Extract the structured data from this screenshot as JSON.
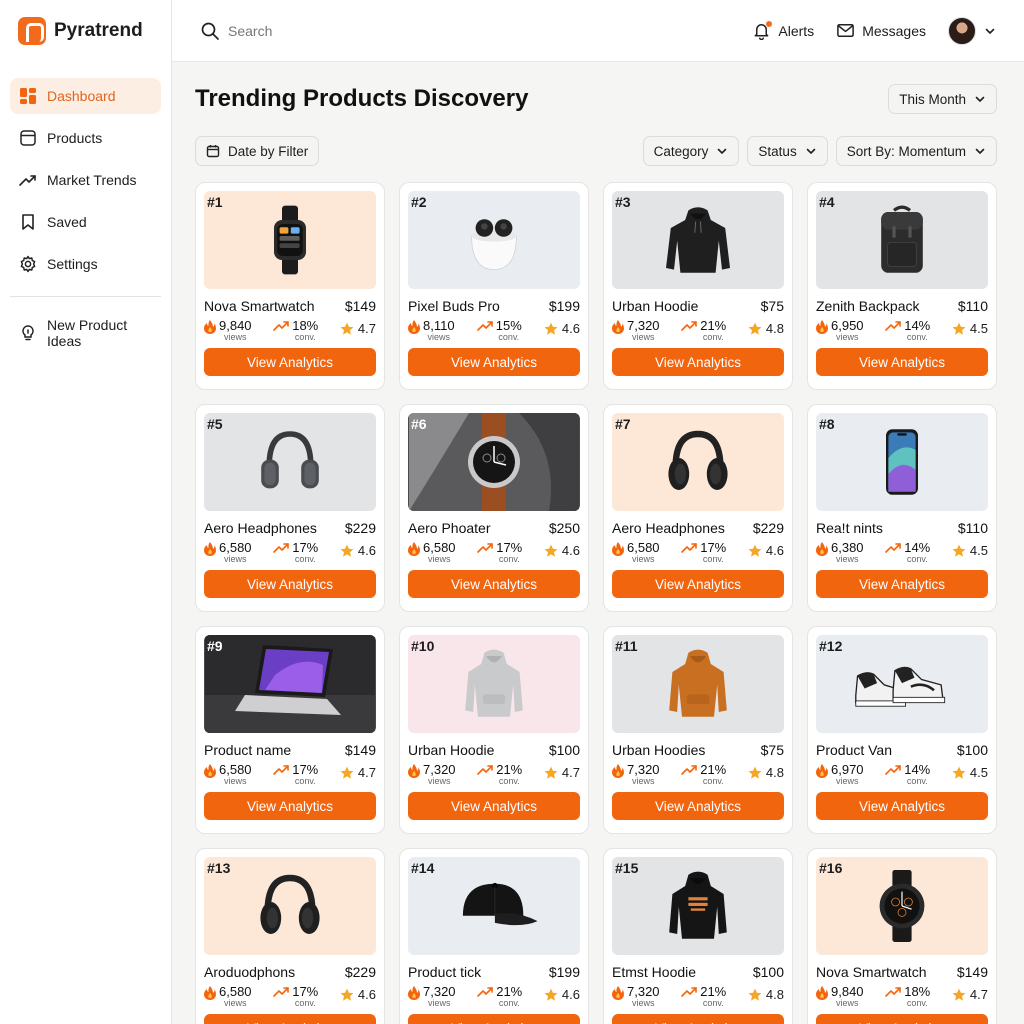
{
  "brand": {
    "name": "Pyratrend"
  },
  "sidebar": {
    "items": [
      {
        "label": "Dashboard",
        "icon": "dashboard-icon",
        "active": true
      },
      {
        "label": "Products",
        "icon": "box-icon"
      },
      {
        "label": "Market Trends",
        "icon": "trend-icon"
      },
      {
        "label": "Saved",
        "icon": "bookmark-icon"
      },
      {
        "label": "Settings",
        "icon": "gear-icon"
      }
    ],
    "secondary": {
      "label": "New Product Ideas",
      "icon": "lightbulb-icon"
    }
  },
  "topbar": {
    "search_placeholder": "Search",
    "alerts_label": "Alerts",
    "messages_label": "Messages"
  },
  "main": {
    "title": "Trending Products Discovery",
    "period_label": "This Month",
    "date_filter_label": "Date by Filter",
    "filters": {
      "category": "Category",
      "status": "Status",
      "sort": "Sort By: Momentum"
    },
    "button_label": "View Analytics",
    "views_caption": "views",
    "conv_caption": "conv."
  },
  "colors": {
    "accent": "#f2650f",
    "peach_bg": "#fde8d8",
    "gray_bg": "#e7e8ea",
    "pink_bg": "#f8e6ea"
  },
  "products": [
    {
      "rank": "#1",
      "name": "Nova Smartwatch",
      "price": "$149",
      "views": "9,840",
      "conv": "18%",
      "rating": "4.7",
      "image": "smartwatch",
      "bg": "peach"
    },
    {
      "rank": "#2",
      "name": "Pixel Buds Pro",
      "price": "$199",
      "views": "8,110",
      "conv": "15%",
      "rating": "4.6",
      "image": "earbuds",
      "bg": "light"
    },
    {
      "rank": "#3",
      "name": "Urban Hoodie",
      "price": "$75",
      "views": "7,320",
      "conv": "21%",
      "rating": "4.8",
      "image": "hoodie-black",
      "bg": "gray"
    },
    {
      "rank": "#4",
      "name": "Zenith Backpack",
      "price": "$110",
      "views": "6,950",
      "conv": "14%",
      "rating": "4.5",
      "image": "backpack",
      "bg": "gray"
    },
    {
      "rank": "#5",
      "name": "Aero Headphones",
      "price": "$229",
      "views": "6,580",
      "conv": "17%",
      "rating": "4.6",
      "image": "headphones-gray",
      "bg": "gray"
    },
    {
      "rank": "#6",
      "name": "Aero Phoater",
      "price": "$250",
      "views": "6,580",
      "conv": "17%",
      "rating": "4.6",
      "image": "watch-leather",
      "bg": "dark"
    },
    {
      "rank": "#7",
      "name": "Aero Headphones",
      "price": "$229",
      "views": "6,580",
      "conv": "17%",
      "rating": "4.6",
      "image": "headphones-black",
      "bg": "peach"
    },
    {
      "rank": "#8",
      "name": "Rea!t nints",
      "price": "$110",
      "views": "6,380",
      "conv": "14%",
      "rating": "4.5",
      "image": "phone",
      "bg": "light"
    },
    {
      "rank": "#9",
      "name": "Product name",
      "price": "$149",
      "views": "6,580",
      "conv": "17%",
      "rating": "4.7",
      "image": "laptop",
      "bg": "dark"
    },
    {
      "rank": "#10",
      "name": "Urban Hoodie",
      "price": "$100",
      "views": "7,320",
      "conv": "21%",
      "rating": "4.7",
      "image": "hoodie-gray",
      "bg": "pink"
    },
    {
      "rank": "#11",
      "name": "Urban Hoodies",
      "price": "$75",
      "views": "7,320",
      "conv": "21%",
      "rating": "4.8",
      "image": "hoodie-orange",
      "bg": "gray"
    },
    {
      "rank": "#12",
      "name": "Product Van",
      "price": "$100",
      "views": "6,970",
      "conv": "14%",
      "rating": "4.5",
      "image": "sneakers",
      "bg": "light"
    },
    {
      "rank": "#13",
      "name": "Aroduodphons",
      "price": "$229",
      "views": "6,580",
      "conv": "17%",
      "rating": "4.6",
      "image": "headphones-black",
      "bg": "peach"
    },
    {
      "rank": "#14",
      "name": "Product tick",
      "price": "$199",
      "views": "7,320",
      "conv": "21%",
      "rating": "4.6",
      "image": "cap",
      "bg": "light"
    },
    {
      "rank": "#15",
      "name": "Etmst Hoodie",
      "price": "$100",
      "views": "7,320",
      "conv": "21%",
      "rating": "4.8",
      "image": "hoodie-print",
      "bg": "gray"
    },
    {
      "rank": "#16",
      "name": "Nova Smartwatch",
      "price": "$149",
      "views": "9,840",
      "conv": "18%",
      "rating": "4.7",
      "image": "watch-chrono",
      "bg": "peach"
    }
  ]
}
